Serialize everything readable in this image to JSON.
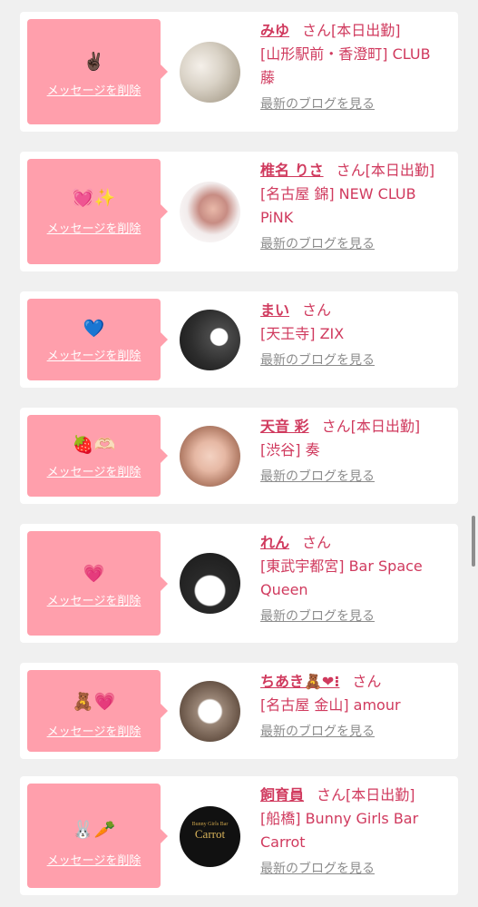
{
  "delete_label": "メッセージを削除",
  "blog_label": "最新のブログを見る",
  "san": "さん",
  "accent_color": "#d03a5e",
  "bubble_color": "#ff9fac",
  "cards": [
    {
      "emoji": "✌🏿",
      "name": "みゆ",
      "suffix": "さん[本日出勤]",
      "shop": "[山形駅前・香澄町] CLUB 藤"
    },
    {
      "emoji": "💓✨",
      "name": "椎名 りさ",
      "suffix": "さん[本日出勤]",
      "shop": "[名古屋 錦] NEW CLUB PiNK"
    },
    {
      "emoji": "💙",
      "name": "まい",
      "suffix": "さん",
      "shop": "[天王寺] ZIX"
    },
    {
      "emoji": "🍓🫶🏻",
      "name": "天音 彩",
      "suffix": "さん[本日出勤]",
      "shop": "[渋谷] 奏"
    },
    {
      "emoji": "💗",
      "name": "れん",
      "suffix": "さん",
      "shop": "[東武宇都宮] Bar Space Queen"
    },
    {
      "emoji": "🧸💗",
      "name": "ちあき🧸❤︎⁝",
      "suffix": "さん",
      "shop": "[名古屋 金山] amour"
    },
    {
      "emoji": "🐰🥕",
      "name": "飼育員",
      "suffix": "さん[本日出勤]",
      "shop": "[船橋] Bunny Girls Bar Carrot"
    }
  ],
  "avatar_logo": {
    "top": "Bunny Girls Bar",
    "main": "Carrot"
  }
}
